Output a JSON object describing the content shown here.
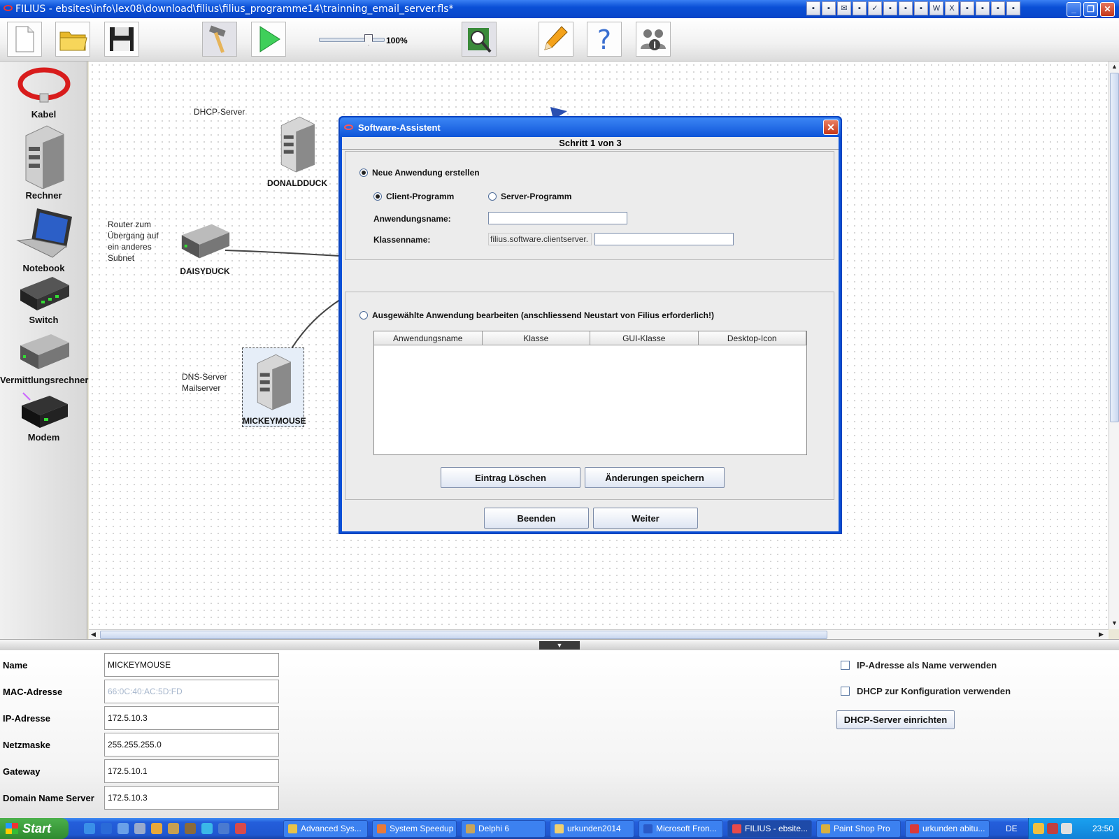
{
  "window": {
    "title": "FILIUS - ebsites\\info\\lex08\\download\\filius\\filius_programme14\\trainning_email_server.fls*",
    "minimize": "_",
    "restore": "❐",
    "close": "✕",
    "tray_icons": [
      "▪",
      "▪",
      "✉",
      "▪",
      "✓",
      "▪",
      "▪",
      "▪",
      "W",
      "X",
      "▪",
      "▪",
      "▪",
      "▪"
    ]
  },
  "toolbar": {
    "new_icon": "new-file-icon",
    "open_icon": "folder-icon",
    "save_icon": "floppy-icon",
    "design_icon": "hammer-icon",
    "run_icon": "play-icon",
    "zoom_label": "100%",
    "zoom_level": 0.8,
    "software_wizard_icon": "wizard-icon",
    "docs_icon": "pencil-icon",
    "help_icon": "question-icon",
    "info_icon": "info-icon"
  },
  "palette": {
    "items": [
      {
        "label": "Kabel"
      },
      {
        "label": "Rechner"
      },
      {
        "label": "Notebook"
      },
      {
        "label": "Switch"
      },
      {
        "label": "Vermittlungsrechner"
      },
      {
        "label": "Modem"
      }
    ]
  },
  "canvas": {
    "notes": [
      {
        "text": "DHCP-Server"
      },
      {
        "text": "Router zum\nÜbergang auf\nein anderes\nSubnet"
      },
      {
        "text": "DNS-Server\nMailserver"
      }
    ],
    "nodes": [
      {
        "name": "DONALDDUCK"
      },
      {
        "name": "DAISYDUCK"
      },
      {
        "name": "MICKEYMOUSE"
      }
    ]
  },
  "dialog": {
    "title": "Software-Assistent",
    "close": "✕",
    "step": "Schritt 1 von 3",
    "new_app": "Neue Anwendung erstellen",
    "client": "Client-Programm",
    "server": "Server-Programm",
    "app_name_label": "Anwendungsname:",
    "class_name_label": "Klassenname:",
    "class_prefix": "filius.software.clientserver.",
    "edit_app": "Ausgewählte Anwendung bearbeiten (anschliessend Neustart von Filius erforderlich!)",
    "table_headers": [
      "Anwendungsname",
      "Klasse",
      "GUI-Klasse",
      "Desktop-Icon"
    ],
    "delete_btn": "Eintrag Löschen",
    "save_btn": "Änderungen speichern",
    "quit_btn": "Beenden",
    "next_btn": "Weiter"
  },
  "props": {
    "rows": [
      {
        "label": "Name",
        "value": "MICKEYMOUSE"
      },
      {
        "label": "MAC-Adresse",
        "value": "66:0C:40:AC:5D:FD"
      },
      {
        "label": "IP-Adresse",
        "value": "172.5.10.3"
      },
      {
        "label": "Netzmaske",
        "value": "255.255.255.0"
      },
      {
        "label": "Gateway",
        "value": "172.5.10.1"
      },
      {
        "label": "Domain Name Server",
        "value": "172.5.10.3"
      }
    ],
    "ip_as_name": "IP-Adresse als Name verwenden",
    "dhcp_config": "DHCP zur Konfiguration verwenden",
    "dhcp_server_btn": "DHCP-Server einrichten"
  },
  "taskbar": {
    "start": "Start",
    "tasks": [
      {
        "label": "Advanced Sys..."
      },
      {
        "label": "System Speedup"
      },
      {
        "label": "Delphi 6"
      },
      {
        "label": "urkunden2014"
      },
      {
        "label": "Microsoft Fron..."
      },
      {
        "label": "FILIUS - ebsite..."
      },
      {
        "label": "Paint Shop Pro"
      },
      {
        "label": "urkunden abitu..."
      }
    ],
    "lang": "DE",
    "clock": "23:50"
  }
}
